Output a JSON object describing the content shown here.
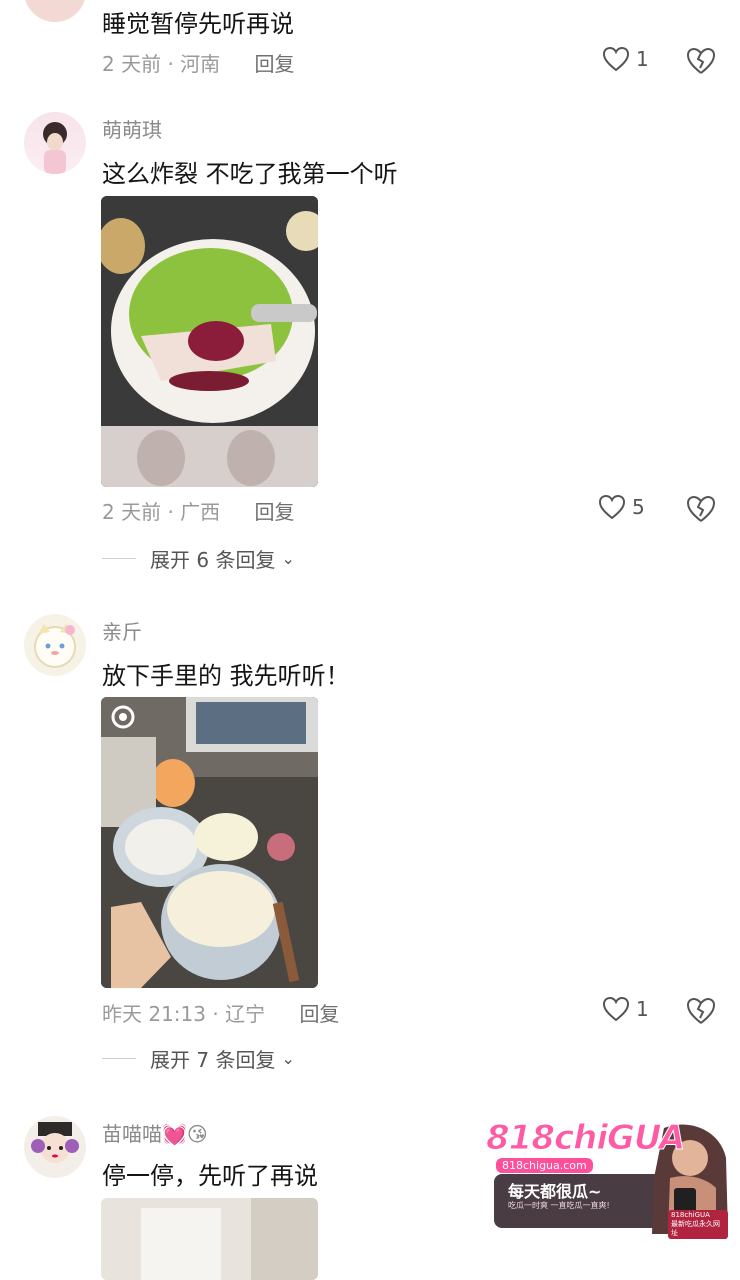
{
  "comments": [
    {
      "text": "睡觉暂停先听再说",
      "time": "2 天前",
      "location": "河南",
      "reply": "回复",
      "likes": "1"
    },
    {
      "username": "萌萌琪",
      "text": "这么炸裂 不吃了我第一个听",
      "time": "2 天前",
      "location": "广西",
      "reply": "回复",
      "likes": "5",
      "expand": "展开 6 条回复"
    },
    {
      "username": "亲斤",
      "text": "放下手里的 我先听听！",
      "time": "昨天 21:13",
      "location": "辽宁",
      "reply": "回复",
      "likes": "1",
      "expand": "展开 7 条回复"
    },
    {
      "username": "苗喵喵💓😘",
      "text": "停一停，先听了再说"
    }
  ],
  "ad": {
    "brand": "818chiGUA",
    "url": "818chigua.com",
    "slogan": "每天都很瓜~",
    "sub": "吃瓜一时爽 一直吃瓜一直爽!",
    "badge1": "818chiGUA",
    "badge2": "最新吃瓜永久网址"
  },
  "colors": {
    "heart": "#555555",
    "meta": "#9a9a9a",
    "adPink": "#ff4f9a"
  }
}
